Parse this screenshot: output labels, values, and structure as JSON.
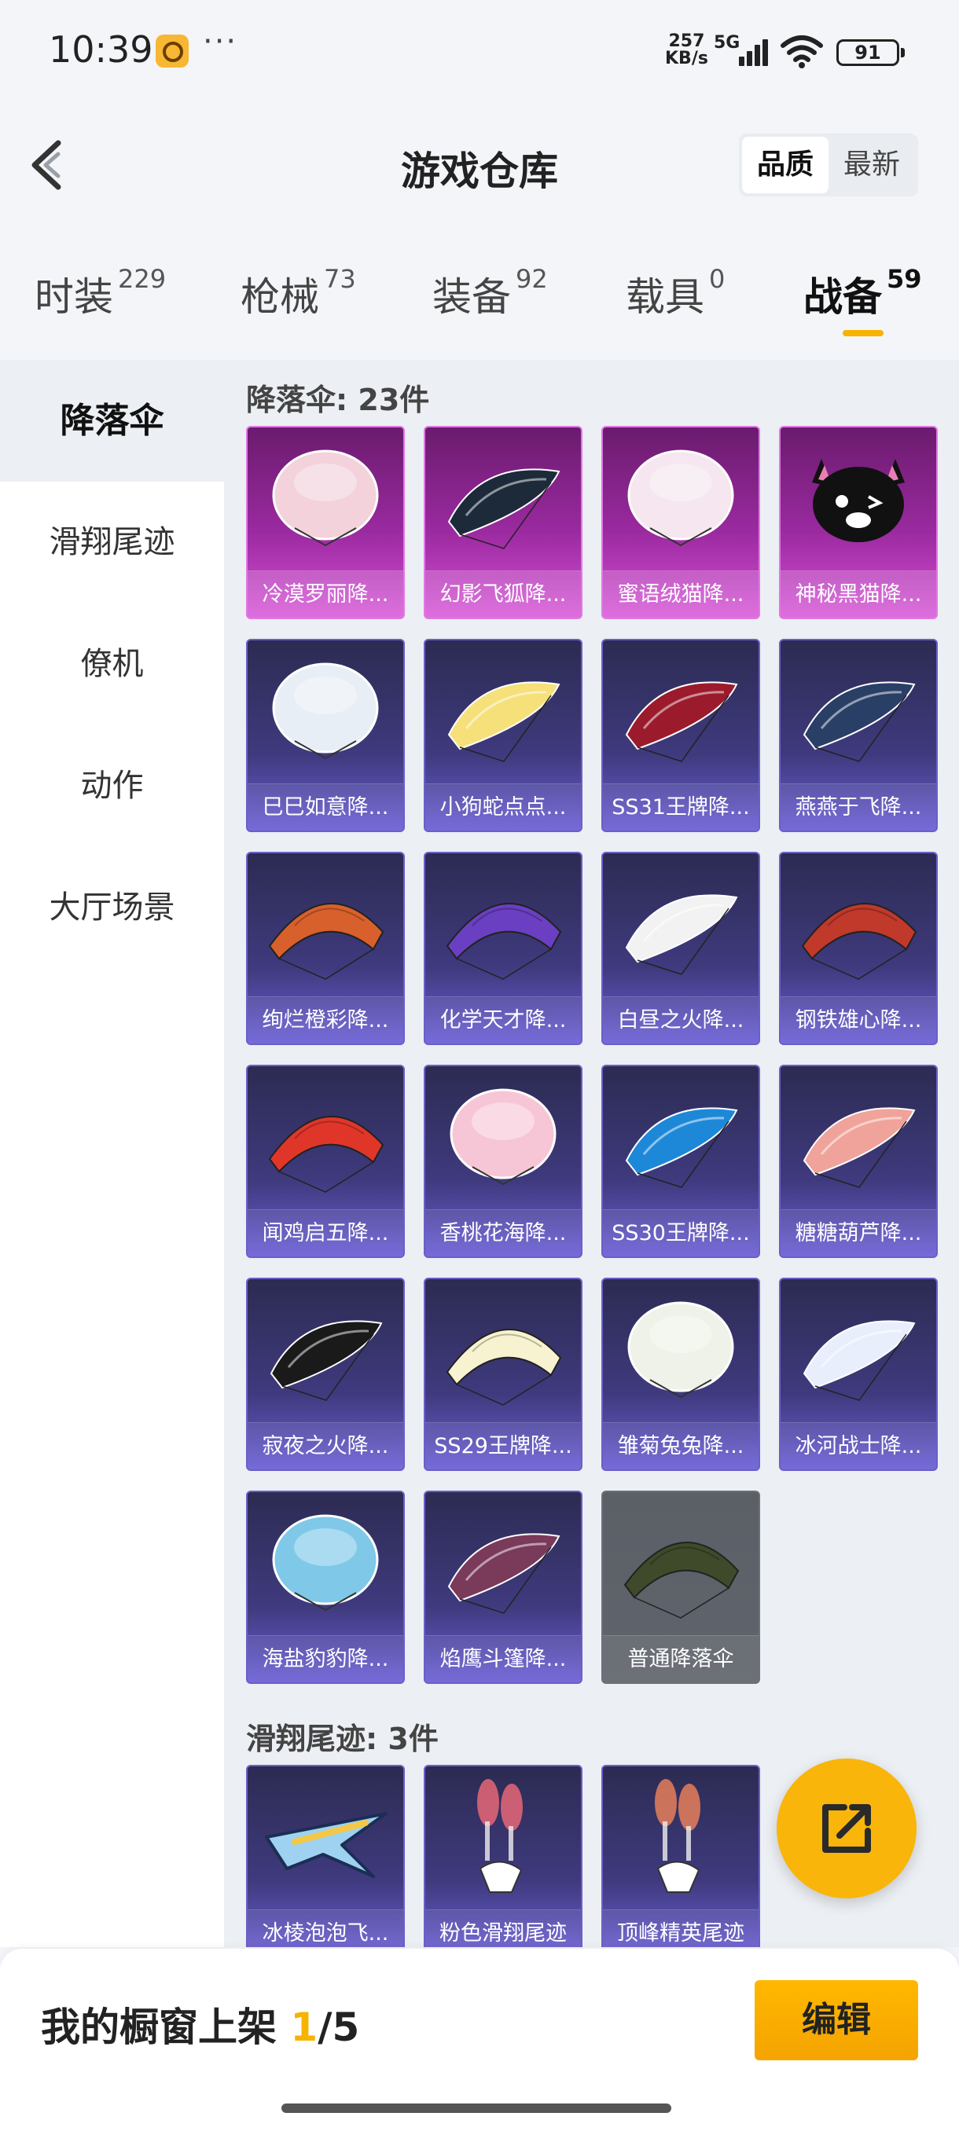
{
  "status_bar": {
    "time": "10:39",
    "dots": "···",
    "speed_value": "257",
    "speed_unit": "KB/s",
    "network": "5G",
    "battery": "91"
  },
  "header": {
    "title": "游戏仓库",
    "sort_options": [
      "品质",
      "最新"
    ],
    "active_sort": "品质"
  },
  "categories": [
    {
      "label": "时装",
      "count": "229"
    },
    {
      "label": "枪械",
      "count": "73"
    },
    {
      "label": "装备",
      "count": "92"
    },
    {
      "label": "载具",
      "count": "0"
    },
    {
      "label": "战备",
      "count": "59"
    }
  ],
  "active_category": "战备",
  "sidebar": {
    "items": [
      "降落伞",
      "滑翔尾迹",
      "僚机",
      "动作",
      "大厅场景"
    ],
    "active": "降落伞"
  },
  "sections": [
    {
      "title": "降落伞: 23件",
      "items": [
        {
          "name": "冷漠罗丽降...",
          "rarity": "pink",
          "icon": "parachute-dome",
          "color": "#f3d2dc"
        },
        {
          "name": "幻影飞狐降...",
          "rarity": "pink",
          "icon": "parachute-wing",
          "color": "#1d2a3a"
        },
        {
          "name": "蜜语绒猫降...",
          "rarity": "pink",
          "icon": "parachute-dome",
          "color": "#f5e6ef"
        },
        {
          "name": "神秘黑猫降...",
          "rarity": "pink",
          "icon": "cat-balloon",
          "color": "#111111"
        },
        {
          "name": "巳巳如意降...",
          "rarity": "purple",
          "icon": "parachute-dome",
          "color": "#e8eef6"
        },
        {
          "name": "小狗蛇点点...",
          "rarity": "purple",
          "icon": "parachute-wing",
          "color": "#f6e07a"
        },
        {
          "name": "SS31王牌降...",
          "rarity": "purple",
          "icon": "parachute-wing",
          "color": "#9b1b2c"
        },
        {
          "name": "燕燕于飞降...",
          "rarity": "purple",
          "icon": "parachute-wing",
          "color": "#2a3f66"
        },
        {
          "name": "绚烂橙彩降...",
          "rarity": "purple",
          "icon": "parachute-canopy",
          "color": "#d8602c"
        },
        {
          "name": "化学天才降...",
          "rarity": "purple",
          "icon": "parachute-canopy",
          "color": "#6a3fc2"
        },
        {
          "name": "白昼之火降...",
          "rarity": "purple",
          "icon": "parachute-wing",
          "color": "#f2f2f2"
        },
        {
          "name": "钢铁雄心降...",
          "rarity": "purple",
          "icon": "parachute-canopy",
          "color": "#c0392b"
        },
        {
          "name": "闻鸡启五降...",
          "rarity": "purple",
          "icon": "parachute-canopy",
          "color": "#e0362a"
        },
        {
          "name": "香桃花海降...",
          "rarity": "purple",
          "icon": "parachute-dome",
          "color": "#f7c6d6"
        },
        {
          "name": "SS30王牌降...",
          "rarity": "purple",
          "icon": "parachute-wing",
          "color": "#1e88d8"
        },
        {
          "name": "糖糖葫芦降...",
          "rarity": "purple",
          "icon": "parachute-wing",
          "color": "#f0a39a"
        },
        {
          "name": "寂夜之火降...",
          "rarity": "purple",
          "icon": "parachute-wing",
          "color": "#1a1a1a"
        },
        {
          "name": "SS29王牌降...",
          "rarity": "purple",
          "icon": "parachute-canopy",
          "color": "#f7f2d0"
        },
        {
          "name": "雏菊兔兔降...",
          "rarity": "purple",
          "icon": "parachute-dome",
          "color": "#eef2e8"
        },
        {
          "name": "冰河战士降...",
          "rarity": "purple",
          "icon": "parachute-wing",
          "color": "#e8eefc"
        },
        {
          "name": "海盐豹豹降...",
          "rarity": "purple",
          "icon": "parachute-dome",
          "color": "#7fc8e8"
        },
        {
          "name": "焰鹰斗篷降...",
          "rarity": "purple",
          "icon": "parachute-wing",
          "color": "#7a3a5a"
        },
        {
          "name": "普通降落伞",
          "rarity": "grey",
          "icon": "parachute-canopy",
          "color": "#3f4a2a"
        }
      ]
    },
    {
      "title": "滑翔尾迹: 3件",
      "items": [
        {
          "name": "冰棱泡泡飞...",
          "rarity": "purple",
          "icon": "glider-plane",
          "color": "#f3c846"
        },
        {
          "name": "粉色滑翔尾迹",
          "rarity": "purple",
          "icon": "smoke-trail",
          "color": "#ff6f7a"
        },
        {
          "name": "顶峰精英尾迹",
          "rarity": "purple",
          "icon": "smoke-trail",
          "color": "#ff8a5a"
        }
      ]
    }
  ],
  "bottom_bar": {
    "label": "我的橱窗上架 ",
    "current": "1",
    "total": "/5",
    "edit_label": "编辑"
  },
  "icons": {
    "back": "back-arrow-icon",
    "share": "share-external-icon"
  }
}
